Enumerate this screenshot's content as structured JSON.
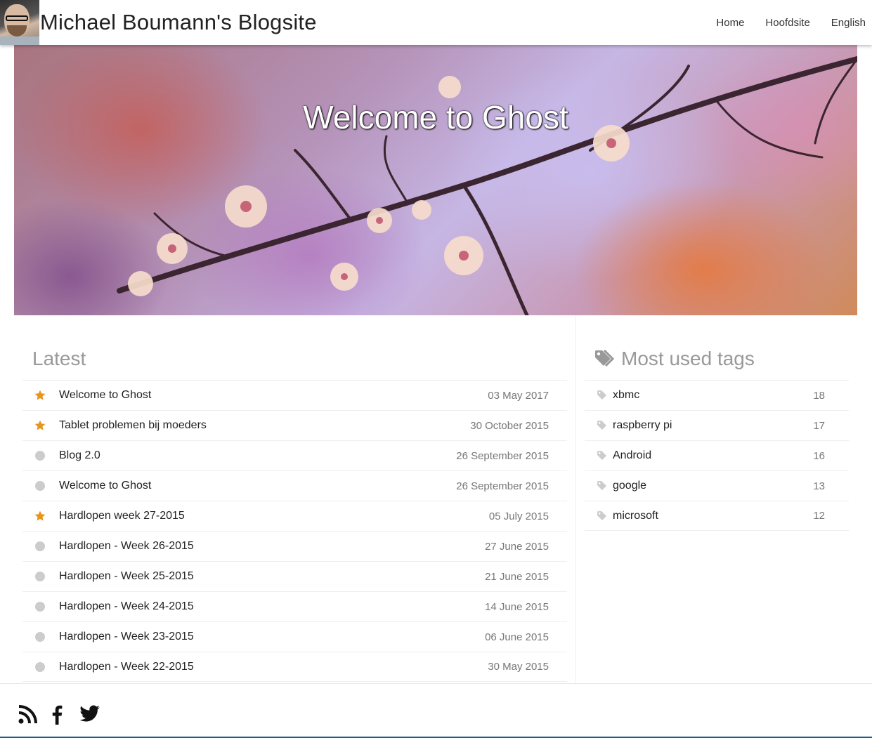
{
  "header": {
    "site_title": "Michael Boumann's Blogsite",
    "nav": [
      "Home",
      "Hoofdsite",
      "English"
    ]
  },
  "hero": {
    "title": "Welcome to Ghost"
  },
  "latest": {
    "heading": "Latest",
    "posts": [
      {
        "title": "Welcome to Ghost",
        "date": "03 May 2017",
        "featured": true
      },
      {
        "title": "Tablet problemen bij moeders",
        "date": "30 October 2015",
        "featured": true
      },
      {
        "title": "Blog 2.0",
        "date": "26 September 2015",
        "featured": false
      },
      {
        "title": "Welcome to Ghost",
        "date": "26 September 2015",
        "featured": false
      },
      {
        "title": "Hardlopen week 27-2015",
        "date": "05 July 2015",
        "featured": true
      },
      {
        "title": "Hardlopen - Week 26-2015",
        "date": "27 June 2015",
        "featured": false
      },
      {
        "title": "Hardlopen - Week 25-2015",
        "date": "21 June 2015",
        "featured": false
      },
      {
        "title": "Hardlopen - Week 24-2015",
        "date": "14 June 2015",
        "featured": false
      },
      {
        "title": "Hardlopen - Week 23-2015",
        "date": "06 June 2015",
        "featured": false
      },
      {
        "title": "Hardlopen - Week 22-2015",
        "date": "30 May 2015",
        "featured": false
      }
    ]
  },
  "tags": {
    "heading": "Most used tags",
    "items": [
      {
        "name": "xbmc",
        "count": "18"
      },
      {
        "name": "raspberry pi",
        "count": "17"
      },
      {
        "name": "Android",
        "count": "16"
      },
      {
        "name": "google",
        "count": "13"
      },
      {
        "name": "microsoft",
        "count": "12"
      }
    ]
  },
  "footer": {
    "social": [
      "rss-icon",
      "facebook-icon",
      "twitter-icon"
    ]
  },
  "colors": {
    "star": "#E8951E",
    "dot": "#CCCCCC",
    "footer_line": "#1C5A8F"
  }
}
